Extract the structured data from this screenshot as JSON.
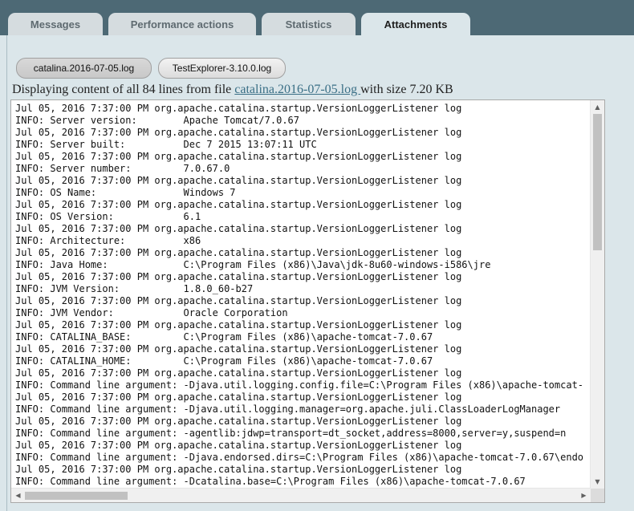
{
  "tabs": [
    {
      "label": "Messages"
    },
    {
      "label": "Performance actions"
    },
    {
      "label": "Statistics"
    },
    {
      "label": "Attachments"
    }
  ],
  "files": [
    {
      "label": "catalina.2016-07-05.log"
    },
    {
      "label": "TestExplorer-3.10.0.log"
    }
  ],
  "info": {
    "prefix": "Displaying content of all 84 lines from file ",
    "filename": "catalina.2016-07-05.log ",
    "suffix": "with size 7.20 KB"
  },
  "log": {
    "lines": [
      "Jul 05, 2016 7:37:00 PM org.apache.catalina.startup.VersionLoggerListener log",
      "INFO: Server version:        Apache Tomcat/7.0.67",
      "Jul 05, 2016 7:37:00 PM org.apache.catalina.startup.VersionLoggerListener log",
      "INFO: Server built:          Dec 7 2015 13:07:11 UTC",
      "Jul 05, 2016 7:37:00 PM org.apache.catalina.startup.VersionLoggerListener log",
      "INFO: Server number:         7.0.67.0",
      "Jul 05, 2016 7:37:00 PM org.apache.catalina.startup.VersionLoggerListener log",
      "INFO: OS Name:               Windows 7",
      "Jul 05, 2016 7:37:00 PM org.apache.catalina.startup.VersionLoggerListener log",
      "INFO: OS Version:            6.1",
      "Jul 05, 2016 7:37:00 PM org.apache.catalina.startup.VersionLoggerListener log",
      "INFO: Architecture:          x86",
      "Jul 05, 2016 7:37:00 PM org.apache.catalina.startup.VersionLoggerListener log",
      "INFO: Java Home:             C:\\Program Files (x86)\\Java\\jdk-8u60-windows-i586\\jre",
      "Jul 05, 2016 7:37:00 PM org.apache.catalina.startup.VersionLoggerListener log",
      "INFO: JVM Version:           1.8.0_60-b27",
      "Jul 05, 2016 7:37:00 PM org.apache.catalina.startup.VersionLoggerListener log",
      "INFO: JVM Vendor:            Oracle Corporation",
      "Jul 05, 2016 7:37:00 PM org.apache.catalina.startup.VersionLoggerListener log",
      "INFO: CATALINA_BASE:         C:\\Program Files (x86)\\apache-tomcat-7.0.67",
      "Jul 05, 2016 7:37:00 PM org.apache.catalina.startup.VersionLoggerListener log",
      "INFO: CATALINA_HOME:         C:\\Program Files (x86)\\apache-tomcat-7.0.67",
      "Jul 05, 2016 7:37:00 PM org.apache.catalina.startup.VersionLoggerListener log",
      "INFO: Command line argument: -Djava.util.logging.config.file=C:\\Program Files (x86)\\apache-tomcat-",
      "Jul 05, 2016 7:37:00 PM org.apache.catalina.startup.VersionLoggerListener log",
      "INFO: Command line argument: -Djava.util.logging.manager=org.apache.juli.ClassLoaderLogManager",
      "Jul 05, 2016 7:37:00 PM org.apache.catalina.startup.VersionLoggerListener log",
      "INFO: Command line argument: -agentlib:jdwp=transport=dt_socket,address=8000,server=y,suspend=n",
      "Jul 05, 2016 7:37:00 PM org.apache.catalina.startup.VersionLoggerListener log",
      "INFO: Command line argument: -Djava.endorsed.dirs=C:\\Program Files (x86)\\apache-tomcat-7.0.67\\endo",
      "Jul 05, 2016 7:37:00 PM org.apache.catalina.startup.VersionLoggerListener log",
      "INFO: Command line argument: -Dcatalina.base=C:\\Program Files (x86)\\apache-tomcat-7.0.67"
    ]
  },
  "icons": {
    "scroll_up": "▲",
    "scroll_down": "▼",
    "scroll_left": "◀",
    "scroll_right": "▶"
  },
  "colors": {
    "header": "#4d6975",
    "panel": "#dbe6ea",
    "link": "#3a6f86"
  }
}
